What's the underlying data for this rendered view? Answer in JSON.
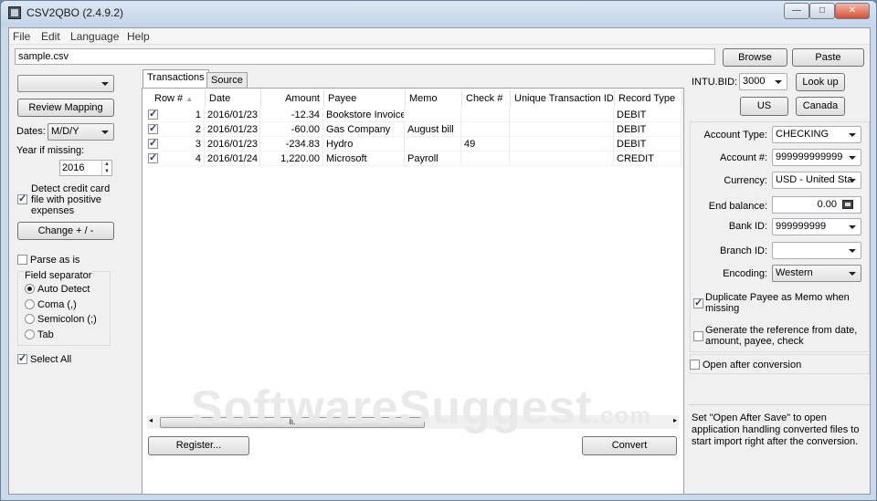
{
  "window": {
    "title": "CSV2QBO (2.4.9.2)",
    "controls": [
      "—",
      "□",
      "✕"
    ]
  },
  "menu": [
    "File",
    "Edit",
    "Language",
    "Help"
  ],
  "file_path": "sample.csv",
  "top_buttons": {
    "browse": "Browse",
    "paste": "Paste"
  },
  "left": {
    "mapping_value": "",
    "review_mapping": "Review Mapping",
    "dates_label": "Dates:",
    "dates_value": "M/D/Y",
    "year_label": "Year if missing:",
    "year_value": "2016",
    "detect_credit_card": "Detect credit card file with positive expenses",
    "change_button": "Change + / -",
    "parse_as_is": "Parse as is",
    "field_separator": "Field separator",
    "separators": [
      "Auto Detect",
      "Coma (,)",
      "Semicolon (;)",
      "Tab"
    ],
    "select_all": "Select All"
  },
  "tabs": [
    "Transactions",
    "Source"
  ],
  "table": {
    "columns": [
      "Row #",
      "Date",
      "Amount",
      "Payee",
      "Memo",
      "Check #",
      "Unique Transaction ID",
      "Record Type"
    ],
    "rows": [
      [
        "1",
        "2016/01/23",
        "-12.34",
        "Bookstore Invoice",
        "",
        "",
        "",
        "DEBIT"
      ],
      [
        "2",
        "2016/01/23",
        "-60.00",
        "Gas Company",
        "August bill",
        "",
        "",
        "DEBIT"
      ],
      [
        "3",
        "2016/01/23",
        "-234.83",
        "Hydro",
        "",
        "49",
        "",
        "DEBIT"
      ],
      [
        "4",
        "2016/01/24",
        "1,220.00",
        "Microsoft",
        "Payroll",
        "",
        "",
        "CREDIT"
      ]
    ]
  },
  "scroll_thumb_glyph": "III",
  "bottom_buttons": {
    "register": "Register...",
    "convert": "Convert"
  },
  "right": {
    "intu_label": "INTU.BID:",
    "intu_value": "3000",
    "lookup": "Look up",
    "us": "US",
    "canada": "Canada",
    "fields": [
      {
        "label": "Account Type:",
        "value": "CHECKING"
      },
      {
        "label": "Account #:",
        "value": "999999999999"
      },
      {
        "label": "Currency:",
        "value": "USD - United Sta"
      },
      {
        "label": "End balance:",
        "value": "0.00"
      },
      {
        "label": "Bank ID:",
        "value": "999999999"
      },
      {
        "label": "Branch ID:",
        "value": ""
      },
      {
        "label": "Encoding:",
        "value": "Western"
      }
    ],
    "duplicate_payee": "Duplicate Payee as Memo when missing",
    "generate_reference": "Generate the reference from date, amount, payee, check",
    "open_after": "Open after conversion",
    "info": "Set \"Open After Save\" to open application handling converted files to start import right after the conversion."
  },
  "watermark": {
    "main": "SoftwareSuggest",
    "suffix": ".com"
  }
}
